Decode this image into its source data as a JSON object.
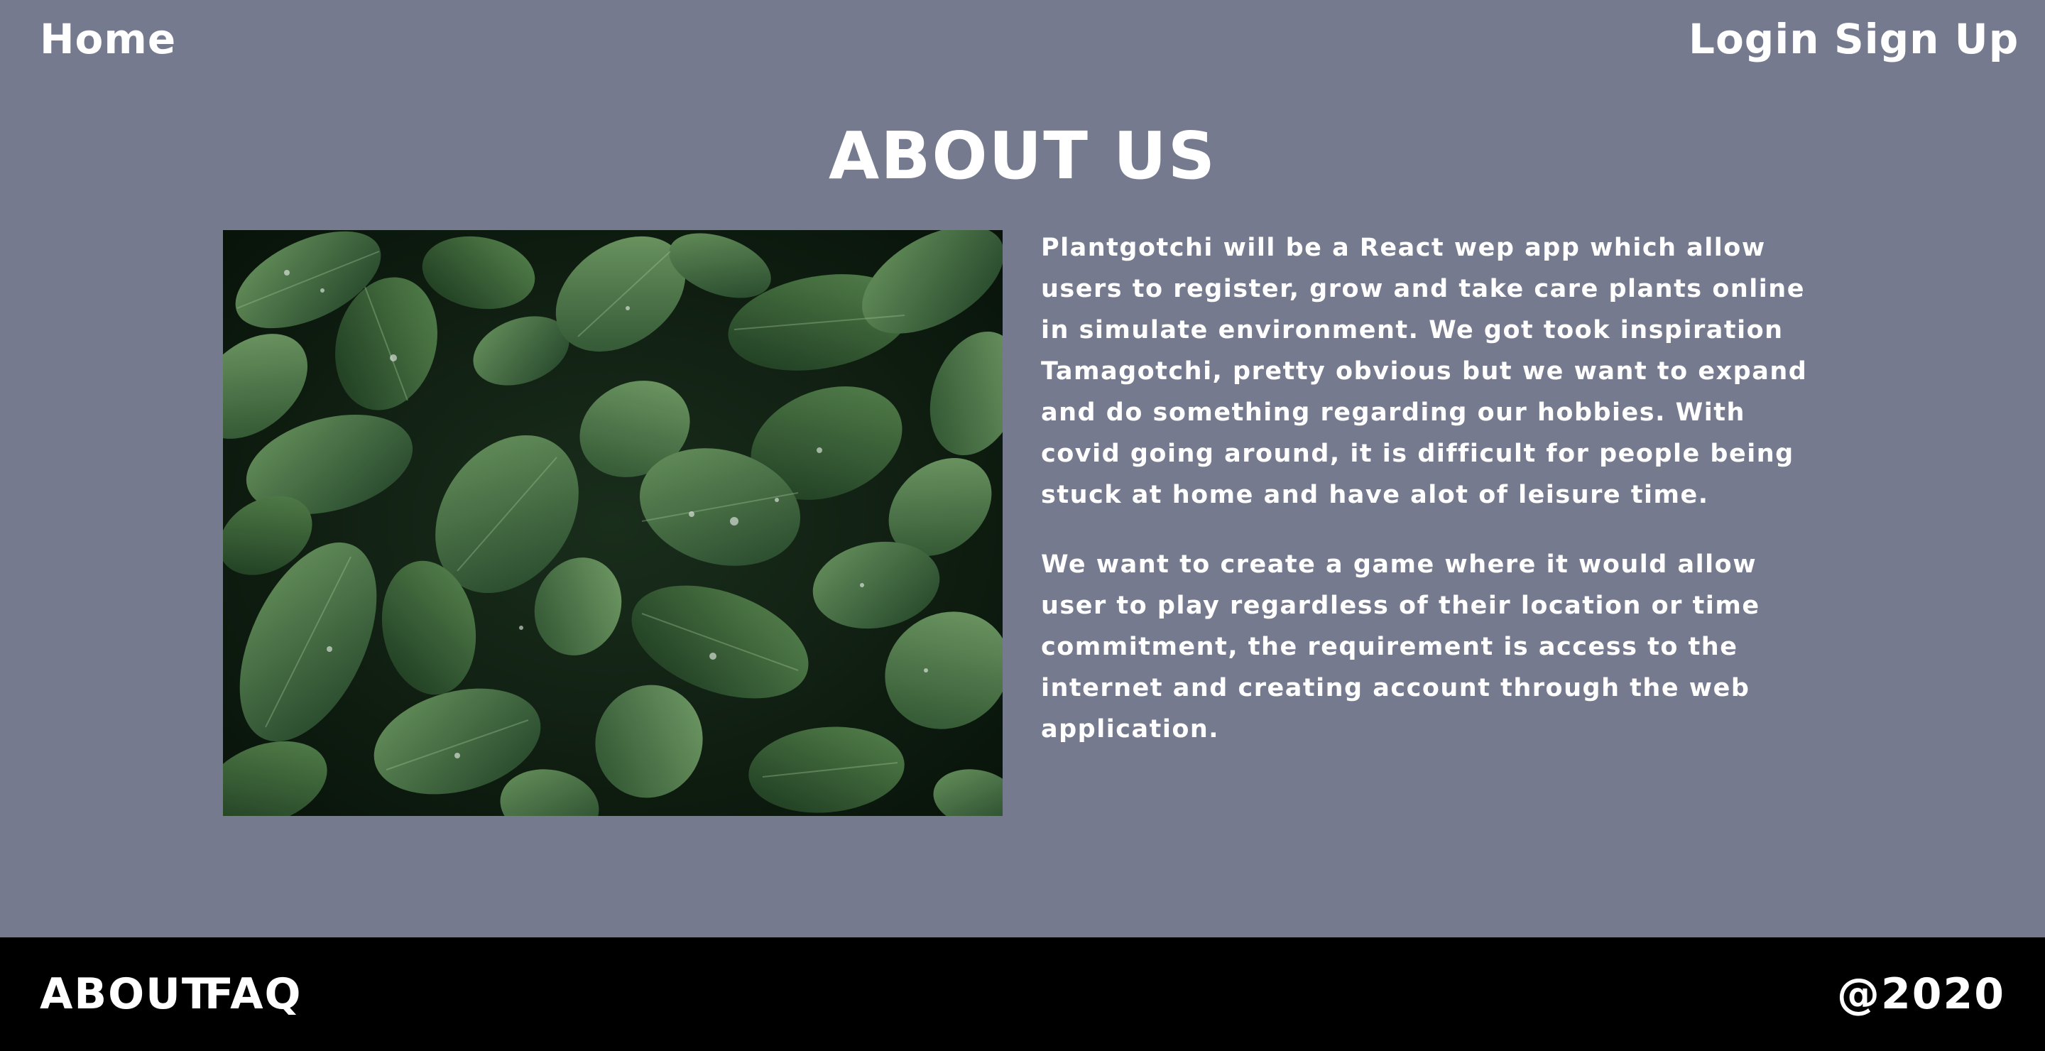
{
  "nav": {
    "home_label": "Home",
    "login_label": "Login",
    "signup_label": "Sign Up"
  },
  "main": {
    "title": "ABOUT US",
    "image_subject": "green leaves with water droplets",
    "paragraph_1": "Plantgotchi will be a React wep app which allow users to register, grow and take care plants online in simulate environment. We got took inspiration Tamagotchi, pretty obvious but we want to expand and do something regarding our hobbies. With covid going around, it is difficult for people being stuck at home and have alot of leisure time.",
    "paragraph_2": "We want to create a game where it would allow user to play regardless of their location or time commitment, the requirement is access to the internet and creating account through the web application."
  },
  "footer": {
    "about_label": "ABOUT",
    "faq_label": "FAQ",
    "copyright": "@2020"
  },
  "colors": {
    "background": "#767a8e",
    "footer_background": "#000000",
    "text": "#ffffff",
    "leaf_dark": "#1f3d22",
    "leaf_light": "#5f8d57"
  }
}
